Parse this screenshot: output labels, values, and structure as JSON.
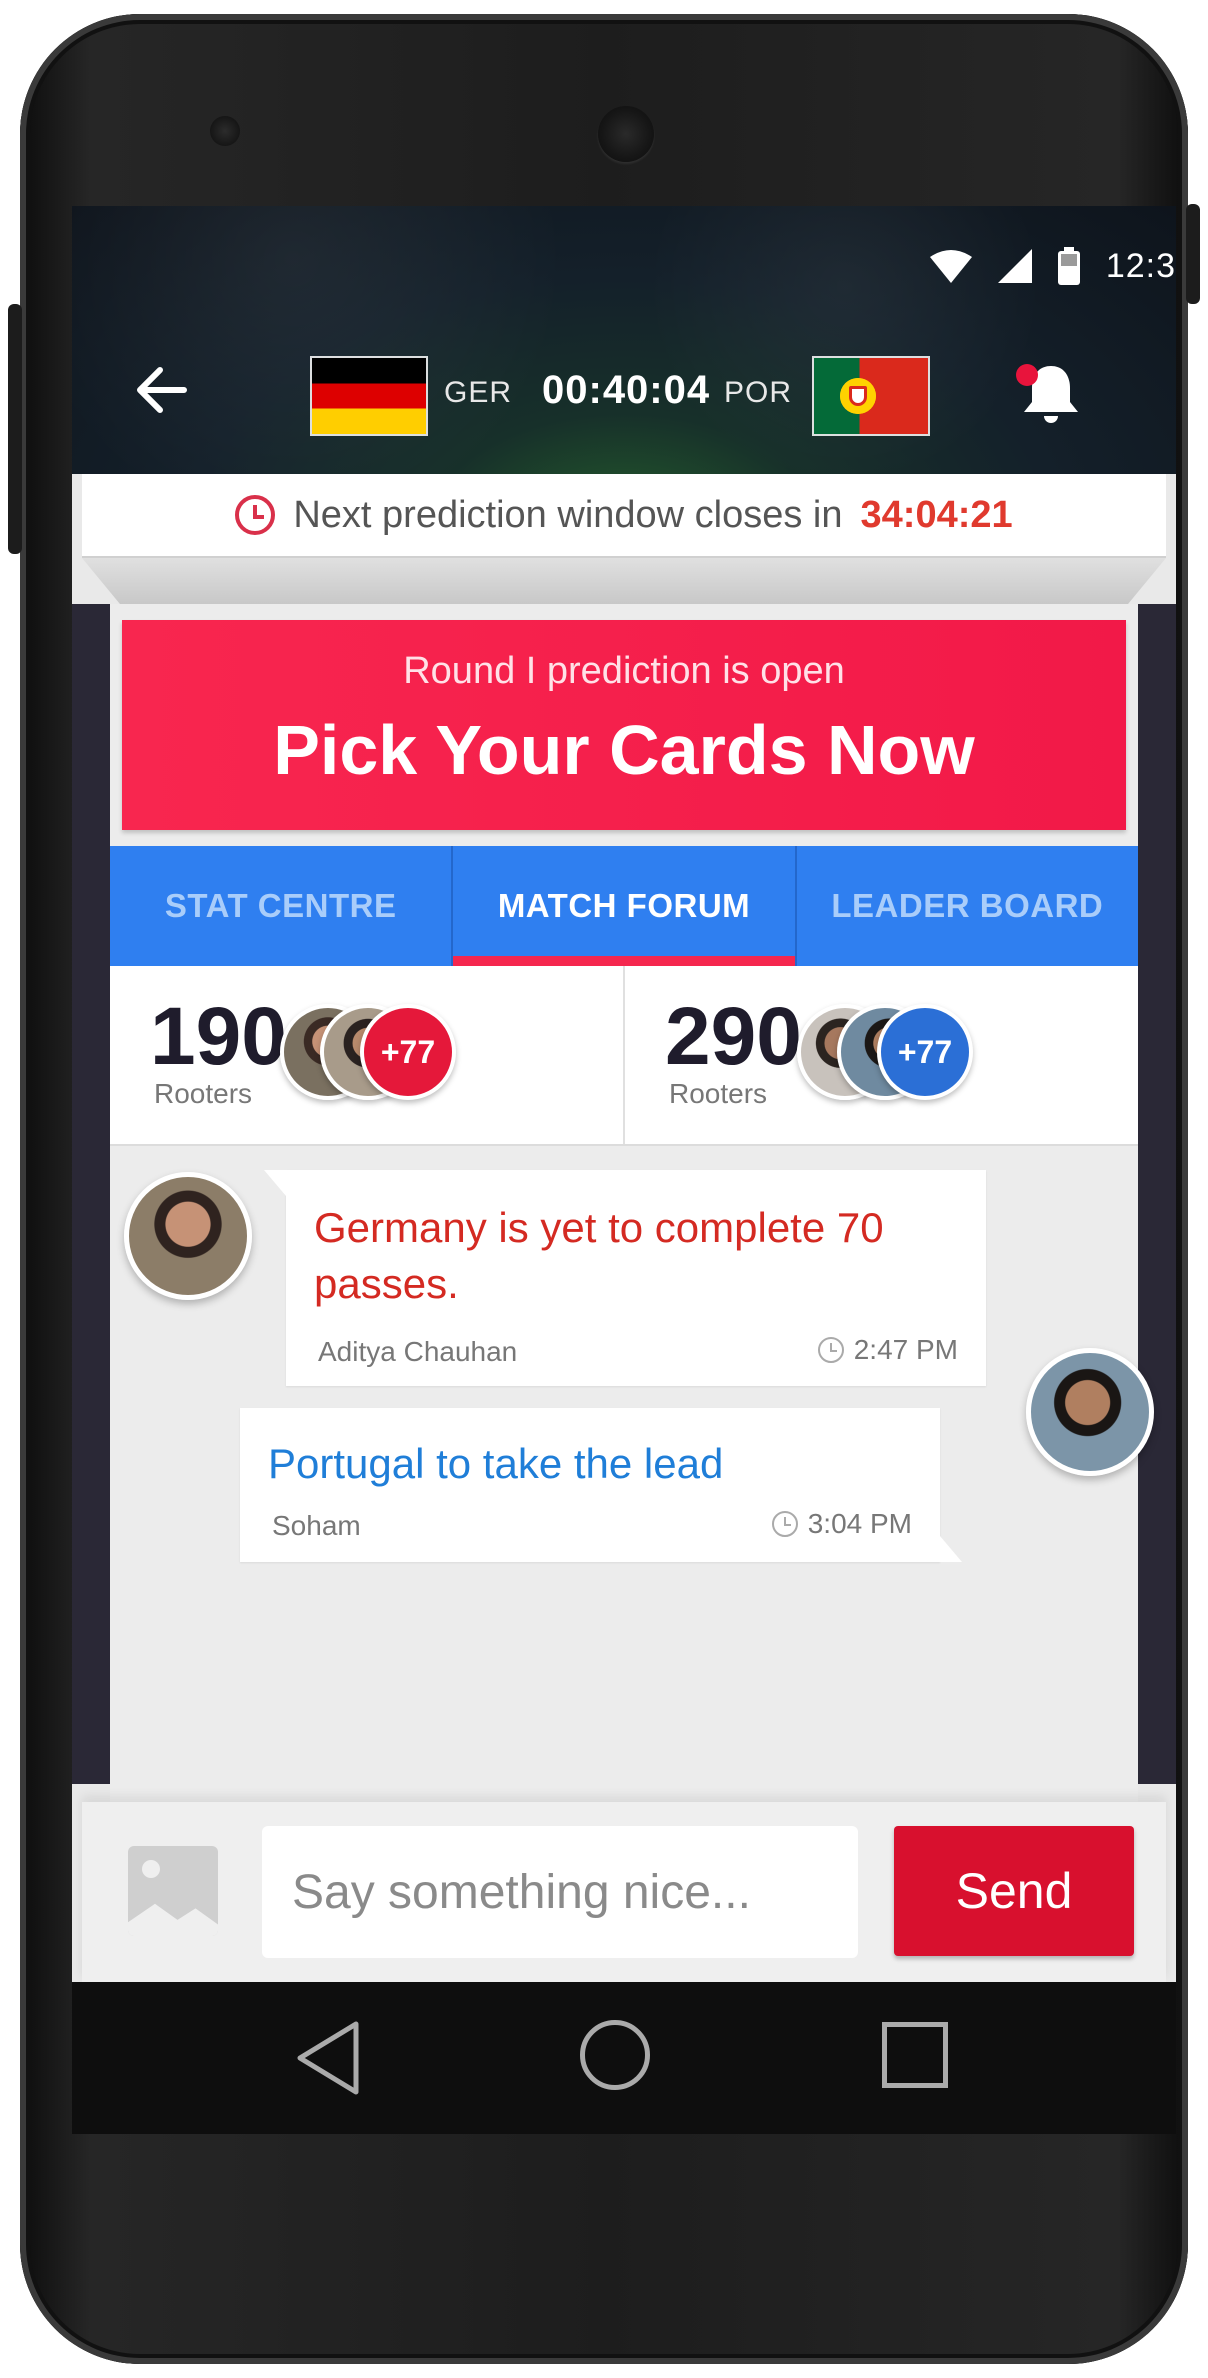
{
  "status": {
    "time": "12:3"
  },
  "header": {
    "home_team": "GER",
    "away_team": "POR",
    "match_clock": "00:40:04"
  },
  "prediction": {
    "label": "Next prediction window closes in",
    "countdown": "34:04:21"
  },
  "banner": {
    "subtitle": "Round I prediction is open",
    "title": "Pick Your Cards Now"
  },
  "tabs": [
    {
      "label": "STAT CENTRE",
      "active": false
    },
    {
      "label": "MATCH FORUM",
      "active": true
    },
    {
      "label": "LEADER BOARD",
      "active": false
    }
  ],
  "rooters": {
    "home": {
      "count": "190",
      "label": "Rooters",
      "more": "+77"
    },
    "away": {
      "count": "290",
      "label": "Rooters",
      "more": "+77"
    }
  },
  "messages": [
    {
      "text": "Germany is yet to complete 70 passes.",
      "author": "Aditya Chauhan",
      "time": "2:47 PM"
    },
    {
      "text": "Portugal to take the lead",
      "author": "Soham",
      "time": "3:04 PM"
    }
  ],
  "composer": {
    "placeholder": "Say something nice...",
    "send_label": "Send"
  },
  "colors": {
    "accent_red": "#f5274e",
    "tab_blue": "#2f7ff0",
    "send_red": "#d8102e",
    "countdown_red": "#e03a2e",
    "home_message": "#d42a22",
    "away_message": "#1f7ed8"
  },
  "icons": {
    "back": "back-arrow-icon",
    "notifications": "bell-icon",
    "image": "image-icon",
    "clock": "clock-icon"
  }
}
